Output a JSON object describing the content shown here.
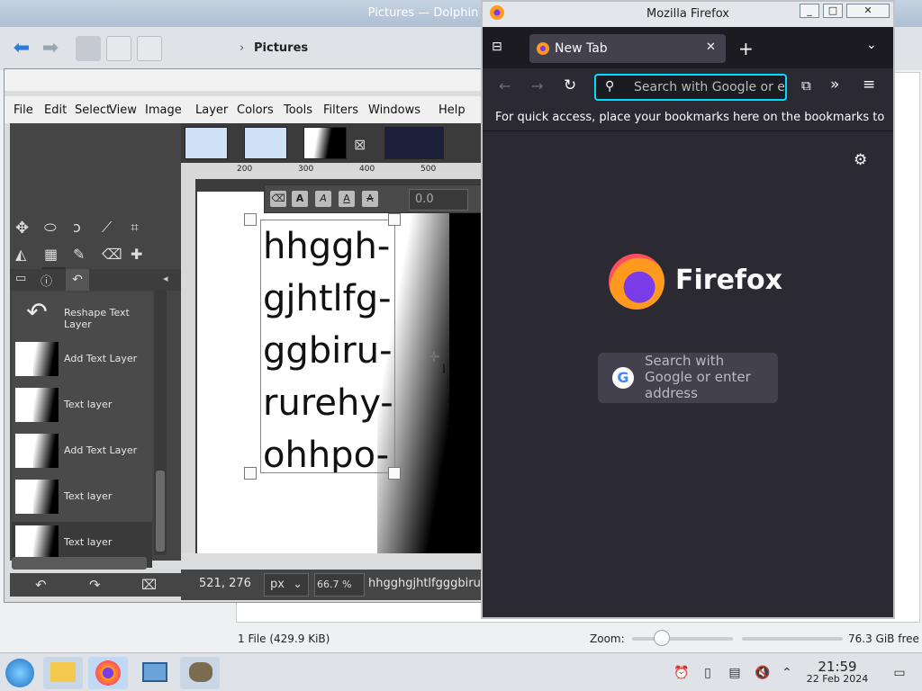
{
  "dolphin": {
    "title": "Pictures — Dolphin",
    "breadcrumb": "Pictures",
    "status_files": "1 File (429.9 KiB)",
    "zoom_label": "Zoom:",
    "free_space": "76.3 GiB free"
  },
  "gimp": {
    "menu": [
      "File",
      "Edit",
      "Select",
      "View",
      "Image",
      "Layer",
      "Colors",
      "Tools",
      "Filters",
      "Windows",
      "Help"
    ],
    "ruler_marks": [
      "200",
      "300",
      "400",
      "500"
    ],
    "text_lines": [
      "hhggh-",
      "gjhtlfg-",
      "ggbiru-",
      "rurehy-",
      "ohhpo-"
    ],
    "text_spin_value": "0.0",
    "history": [
      {
        "label": "Reshape Text Layer",
        "type": "undo-arrow"
      },
      {
        "label": "Add Text Layer",
        "type": "thumb"
      },
      {
        "label": "Text layer",
        "type": "thumb"
      },
      {
        "label": "Add Text Layer",
        "type": "thumb"
      },
      {
        "label": "Text layer",
        "type": "thumb"
      },
      {
        "label": "Text layer",
        "type": "thumb"
      }
    ],
    "coords": "521, 276",
    "unit": "px",
    "zoom": "66.7 %",
    "status_text": "hhgghgjhtlfgggbirur"
  },
  "firefox": {
    "window_title": "Mozilla Firefox",
    "tab_label": "New Tab",
    "url_placeholder": "Search with Google or e",
    "bookmarks_hint": "For quick access, place your bookmarks here on the bookmarks to",
    "brand": "Firefox",
    "search_line1": "Search with",
    "search_line2": "Google or enter",
    "search_line3": "address",
    "google_letter": "G"
  },
  "taskbar": {
    "time": "21:59",
    "date": "22 Feb 2024"
  },
  "colors": {
    "firefox_bg": "#2b2a33",
    "url_focus": "#00ddff",
    "gimp_dark": "#454545"
  }
}
